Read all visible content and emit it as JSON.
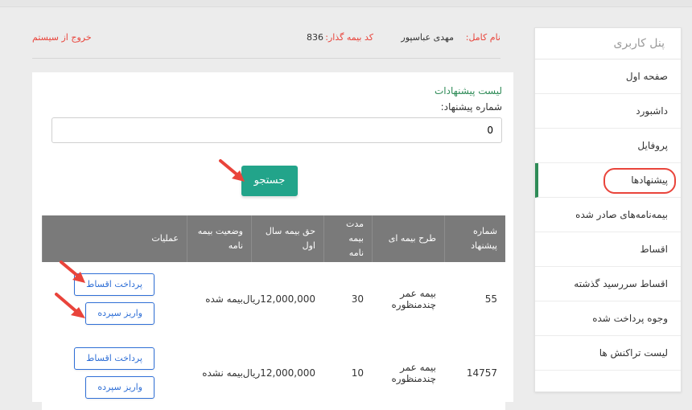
{
  "sidebar": {
    "title": "پنل کاربری",
    "items": [
      {
        "label": "صفحه اول"
      },
      {
        "label": "داشبورد"
      },
      {
        "label": "پروفایل"
      },
      {
        "label": "پیشنهادها"
      },
      {
        "label": "بیمه‌نامه‌های صادر شده"
      },
      {
        "label": "اقساط"
      },
      {
        "label": "اقساط سررسید گذشته"
      },
      {
        "label": "وجوه پرداخت شده"
      },
      {
        "label": "لیست تراکنش ها"
      }
    ]
  },
  "header": {
    "name_label": "نام کامل:",
    "name_value": "مهدی عباسپور",
    "code_label": "کد بیمه گذار:",
    "code_value": "836",
    "exit_label": "خروج از سیستم"
  },
  "main": {
    "list_title": "لیست پیشنهادات",
    "number_label": "شماره پیشنهاد:",
    "number_value": "0",
    "search_label": "جستجو"
  },
  "table": {
    "headers": [
      "شماره پیشنهاد",
      "طرح بیمه ای",
      "مدت بیمه نامه",
      "حق بیمه سال اول",
      "وضعیت بیمه نامه",
      "عملیات"
    ],
    "rows": [
      {
        "number": "55",
        "plan": "بیمه عمر چندمنظوره",
        "duration": "30",
        "premium": "12,000,000ریال",
        "status": "بیمه شده",
        "op1": "پرداخت اقساط",
        "op2": "واریز سپرده"
      },
      {
        "number": "14757",
        "plan": "بیمه عمر چندمنظوره",
        "duration": "10",
        "premium": "12,000,000ریال",
        "status": "بیمه نشده",
        "op1": "پرداخت اقساط",
        "op2": "واریز سپرده"
      }
    ]
  },
  "colors": {
    "accent_green": "#22a48a",
    "annotation_red": "#e9443b",
    "table_header": "#7a7a7a",
    "link_blue": "#2f6fd6"
  }
}
